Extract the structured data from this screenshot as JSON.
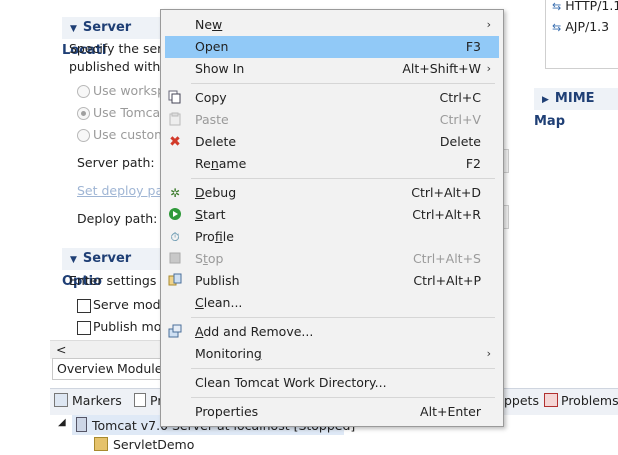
{
  "editor": {
    "server_locations": {
      "title": "Server Locati",
      "desc_line1": "Specify the serv",
      "desc_line2": "published with r",
      "options": [
        "Use worksp",
        "Use Tomcat",
        "Use custom"
      ],
      "server_path_label": "Server path:",
      "set_deploy_link": "Set deploy pa",
      "deploy_path_label": "Deploy path:"
    },
    "server_options": {
      "title": "Server Optio",
      "desc": "Enter settings fo",
      "checkboxes": [
        "Serve modu",
        "Publish mod"
      ]
    },
    "right": {
      "protocols": [
        "HTTP/1.1",
        "AJP/1.3"
      ],
      "mime_title": "MIME Map"
    },
    "tabs": [
      "Overview",
      "Module"
    ],
    "scroll_left": "<"
  },
  "bottom_panel": {
    "tabs": {
      "markers": "Markers",
      "pr": "Pr",
      "snippets": "ppets",
      "problems": "Problems"
    },
    "tree": {
      "server": "Tomcat v7.0 Server at localhost  [Stopped]",
      "child": "ServletDemo"
    }
  },
  "menu": {
    "items": [
      {
        "label": "New",
        "mnemonic_idx": 2,
        "submenu": true
      },
      {
        "label": "Open",
        "shortcut": "F3"
      },
      {
        "label": "Show In",
        "shortcut": "Alt+Shift+W",
        "submenu": true
      },
      {
        "label": "Copy",
        "shortcut": "Ctrl+C",
        "icon": "copy-icon"
      },
      {
        "label": "Paste",
        "shortcut": "Ctrl+V",
        "icon": "paste-icon",
        "disabled": true
      },
      {
        "label": "Delete",
        "shortcut": "Delete",
        "icon": "delete-icon"
      },
      {
        "label": "Rename",
        "shortcut": "F2"
      },
      {
        "label": "Debug",
        "shortcut": "Ctrl+Alt+D",
        "icon": "debug-icon"
      },
      {
        "label": "Start",
        "shortcut": "Ctrl+Alt+R",
        "icon": "start-icon"
      },
      {
        "label": "Profile",
        "icon": "profile-icon"
      },
      {
        "label": "Stop",
        "shortcut": "Ctrl+Alt+S",
        "icon": "stop-icon",
        "disabled": true
      },
      {
        "label": "Publish",
        "shortcut": "Ctrl+Alt+P",
        "icon": "publish-icon"
      },
      {
        "label": "Clean..."
      },
      {
        "label": "Add and Remove...",
        "icon": "add-remove-icon"
      },
      {
        "label": "Monitoring",
        "submenu": true
      },
      {
        "label": "Clean Tomcat Work Directory..."
      },
      {
        "label": "Properties",
        "shortcut": "Alt+Enter"
      }
    ],
    "submenu_arrow": "›",
    "highlight_color": "#91c9f7"
  }
}
